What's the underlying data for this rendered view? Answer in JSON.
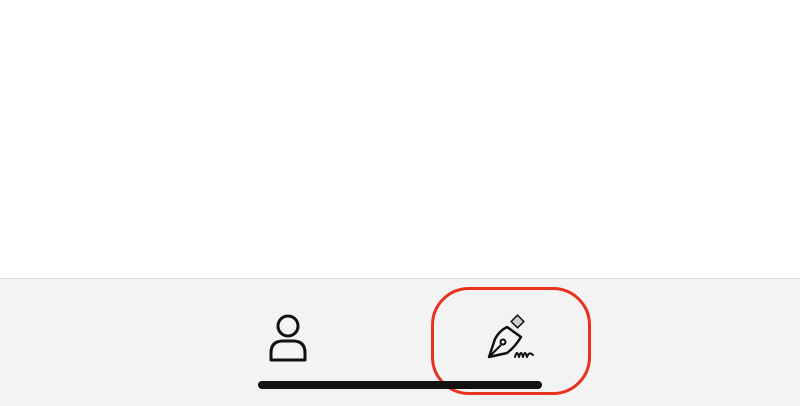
{
  "tab_bar": {
    "tabs": [
      {
        "icon": "person-icon",
        "selected": false
      },
      {
        "icon": "pen-nib-signature-icon",
        "selected": true
      }
    ]
  },
  "colors": {
    "tab_bar_background": "#f3f3f3",
    "icon_stroke": "#111111",
    "highlight_ring": "#e8321f",
    "home_indicator": "#111111"
  }
}
